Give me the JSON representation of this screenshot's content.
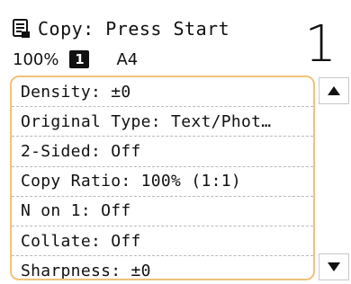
{
  "header": {
    "title": "Copy: Press Start",
    "copy_ratio": "100%",
    "tray": "1",
    "paper": "A4",
    "copies": "1",
    "icon": "copy-icon"
  },
  "menu": {
    "items": [
      {
        "label": "Density: ±0"
      },
      {
        "label": "Original Type: Text/Phot…"
      },
      {
        "label": "2-Sided: Off"
      },
      {
        "label": "Copy Ratio: 100% (1:1)"
      },
      {
        "label": "N on 1: Off"
      },
      {
        "label": "Collate: Off"
      },
      {
        "label": "Sharpness: ±0"
      }
    ],
    "highlight_color": "#f0c27a"
  },
  "scroll": {
    "up_icon": "triangle-up-icon",
    "down_icon": "triangle-down-icon"
  }
}
